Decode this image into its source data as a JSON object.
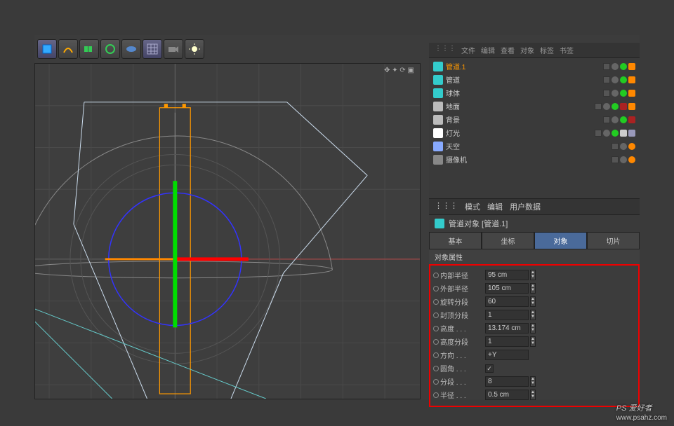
{
  "toolbar": {
    "icons": [
      "cube",
      "pen",
      "array",
      "deformer",
      "plane",
      "floor",
      "camera",
      "light"
    ]
  },
  "viewport": {
    "nav_icons": "✥ ✦ ⟳ ▣"
  },
  "objects": {
    "menu": [
      "文件",
      "编辑",
      "查看",
      "对象",
      "标签",
      "书签"
    ],
    "items": [
      {
        "name": "管道.1",
        "selected": true,
        "icon": "#3cc",
        "dots": [
          "#666",
          "#2c2"
        ],
        "tags": [
          "#f80"
        ]
      },
      {
        "name": "管道",
        "selected": false,
        "icon": "#3cc",
        "dots": [
          "#666",
          "#2c2"
        ],
        "tags": [
          "#f80"
        ]
      },
      {
        "name": "球体",
        "selected": false,
        "icon": "#3cc",
        "dots": [
          "#666",
          "#2c2"
        ],
        "tags": [
          "#f80"
        ]
      },
      {
        "name": "地面",
        "selected": false,
        "icon": "#bbb",
        "dots": [
          "#666",
          "#2c2"
        ],
        "tags": [
          "#a22",
          "#f80"
        ]
      },
      {
        "name": "背景",
        "selected": false,
        "icon": "#bbb",
        "dots": [
          "#666",
          "#2c2"
        ],
        "tags": [
          "#a22"
        ]
      },
      {
        "name": "灯光",
        "selected": false,
        "icon": "#fff",
        "dots": [
          "#666",
          "#2c2"
        ],
        "tags": [
          "#ccc",
          "#99b"
        ]
      },
      {
        "name": "天空",
        "selected": false,
        "icon": "#8af",
        "dots": [
          "#666",
          "#f80"
        ],
        "tags": []
      },
      {
        "name": "摄像机",
        "selected": false,
        "icon": "#888",
        "dots": [
          "#666",
          "#f80"
        ],
        "tags": []
      }
    ]
  },
  "attributes": {
    "menu": [
      "模式",
      "编辑",
      "用户数据"
    ],
    "title": "管道对象 [管道.1]",
    "tabs": [
      {
        "label": "基本",
        "active": false
      },
      {
        "label": "坐标",
        "active": false
      },
      {
        "label": "对象",
        "active": true
      },
      {
        "label": "切片",
        "active": false
      }
    ],
    "section": "对象属性",
    "props": [
      {
        "label": "内部半径",
        "value": "95 cm",
        "spinner": true
      },
      {
        "label": "外部半径",
        "value": "105 cm",
        "spinner": true
      },
      {
        "label": "旋转分段",
        "value": "60",
        "spinner": true
      },
      {
        "label": "封顶分段",
        "value": "1",
        "spinner": true
      },
      {
        "label": "高度 . . .",
        "value": "13.174 cm",
        "spinner": true
      },
      {
        "label": "高度分段",
        "value": "1",
        "spinner": true
      },
      {
        "label": "方向 . . .",
        "value": "+Y",
        "spinner": false
      },
      {
        "label": "圆角 . . .",
        "value": "check",
        "spinner": false
      },
      {
        "label": "分段 . . .",
        "value": "8",
        "spinner": true
      },
      {
        "label": "半径 . . .",
        "value": "0.5 cm",
        "spinner": true
      }
    ]
  },
  "watermark": {
    "brand": "PS 爱好者",
    "url": "www.psahz.com"
  }
}
